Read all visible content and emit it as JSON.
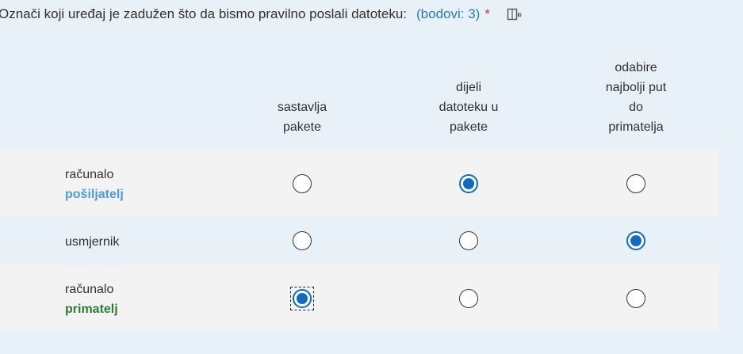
{
  "question": {
    "text": "Označi koji uređaj je zadužen što da bismo pravilno poslali datoteku:",
    "points": "(bodovi: 3)",
    "required_mark": "*",
    "reader_icon": "immersive-reader-icon"
  },
  "columns": [
    "sastavlja\npakete",
    "dijeli\ndatoteku u\npakete",
    "odabire\nnajbolji put\ndo\nprimatelja"
  ],
  "rows": [
    {
      "label": "računalo",
      "sublabel": "pošiljatelj",
      "sublabel_color": "#4a9de0",
      "selected": 1
    },
    {
      "label": "usmjernik",
      "sublabel": "",
      "sublabel_color": "",
      "selected": 2
    },
    {
      "label": "računalo",
      "sublabel": "primatelj",
      "sublabel_color": "#2e7d32",
      "selected": 0
    }
  ],
  "colors": {
    "accent": "#0f6cbd",
    "background": "#e8f0f8",
    "row_shade": "#f3f3f3",
    "required": "#c4314b",
    "points": "#2b7bb9"
  }
}
